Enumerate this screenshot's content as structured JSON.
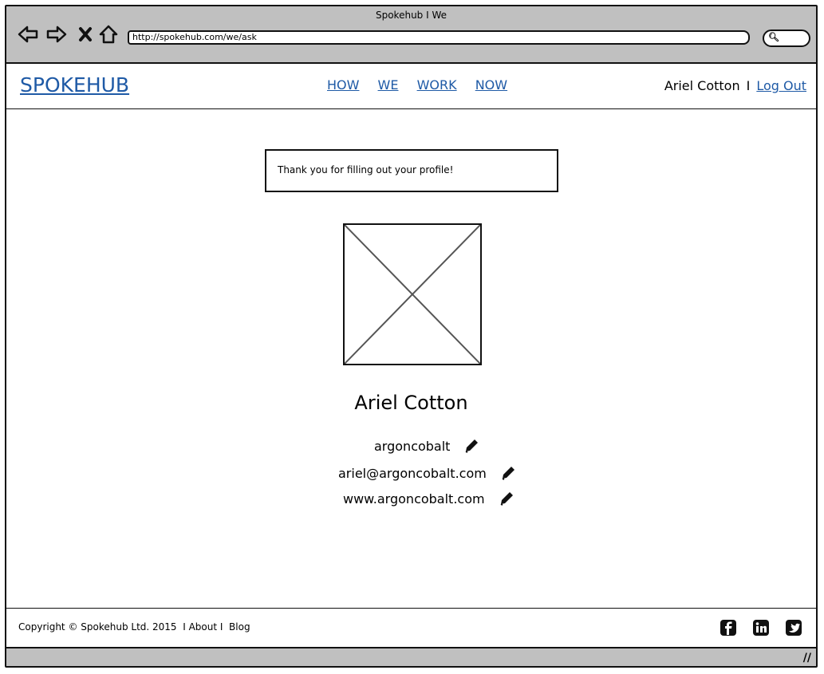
{
  "browser": {
    "window_title": "Spokehub I We",
    "url": "http://spokehub.com/we/ask"
  },
  "header": {
    "logo": "SPOKEHUB",
    "nav": [
      {
        "label": "HOW"
      },
      {
        "label": "WE"
      },
      {
        "label": "WORK"
      },
      {
        "label": "NOW"
      }
    ],
    "user_name": "Ariel Cotton",
    "separator": "I",
    "logout_label": "Log Out"
  },
  "notice": {
    "text": "Thank you for filling out your profile!"
  },
  "profile": {
    "name": "Ariel Cotton",
    "username": "argoncobalt",
    "email": "ariel@argoncobalt.com",
    "website": "www.argoncobalt.com"
  },
  "footer": {
    "copyright": "Copyright © Spokehub Ltd. 2015",
    "about": "About",
    "blog": "Blog",
    "social": [
      "facebook-icon",
      "linkedin-icon",
      "twitter-icon"
    ]
  },
  "colors": {
    "link": "#1f5aa6",
    "chrome": "#c0c0c0"
  }
}
